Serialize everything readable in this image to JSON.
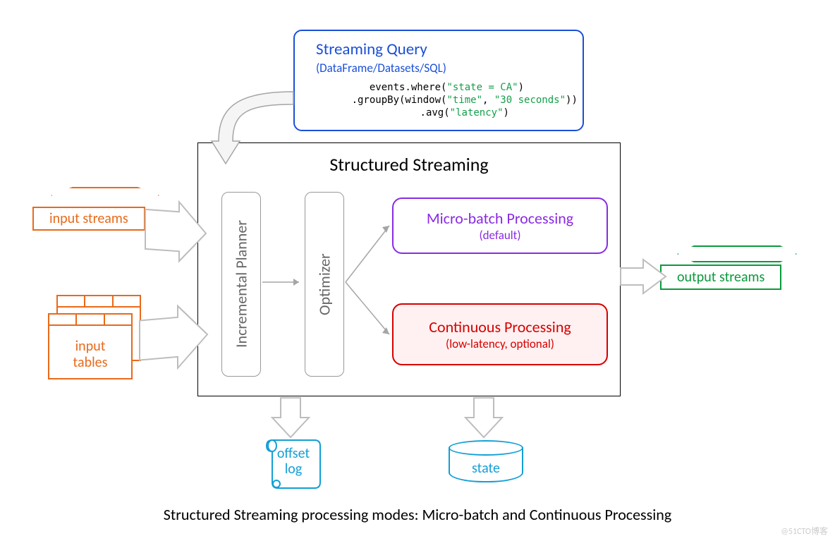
{
  "query": {
    "title": "Streaming Query",
    "subtitle": "(DataFrame/Datasets/SQL)",
    "code_plain": "events.where(\"state = CA\")\n      .groupBy(window(\"time\", \"30 seconds\"))\n      .avg(\"latency\")"
  },
  "main": {
    "title": "Structured Streaming",
    "planner": "Incremental Planner",
    "optimizer": "Optimizer"
  },
  "modes": {
    "micro": {
      "title": "Micro-batch Processing",
      "sub": "(default)"
    },
    "continuous": {
      "title": "Continuous Processing",
      "sub": "(low-latency, optional)"
    }
  },
  "inputs": {
    "streams": "input streams",
    "tables": "input\ntables"
  },
  "outputs": {
    "streams": "output streams"
  },
  "sinks": {
    "offset_log": "offset\nlog",
    "state": "state"
  },
  "caption": "Structured Streaming processing modes: Micro-batch and Continuous Processing",
  "watermark": "@51CTO博客"
}
